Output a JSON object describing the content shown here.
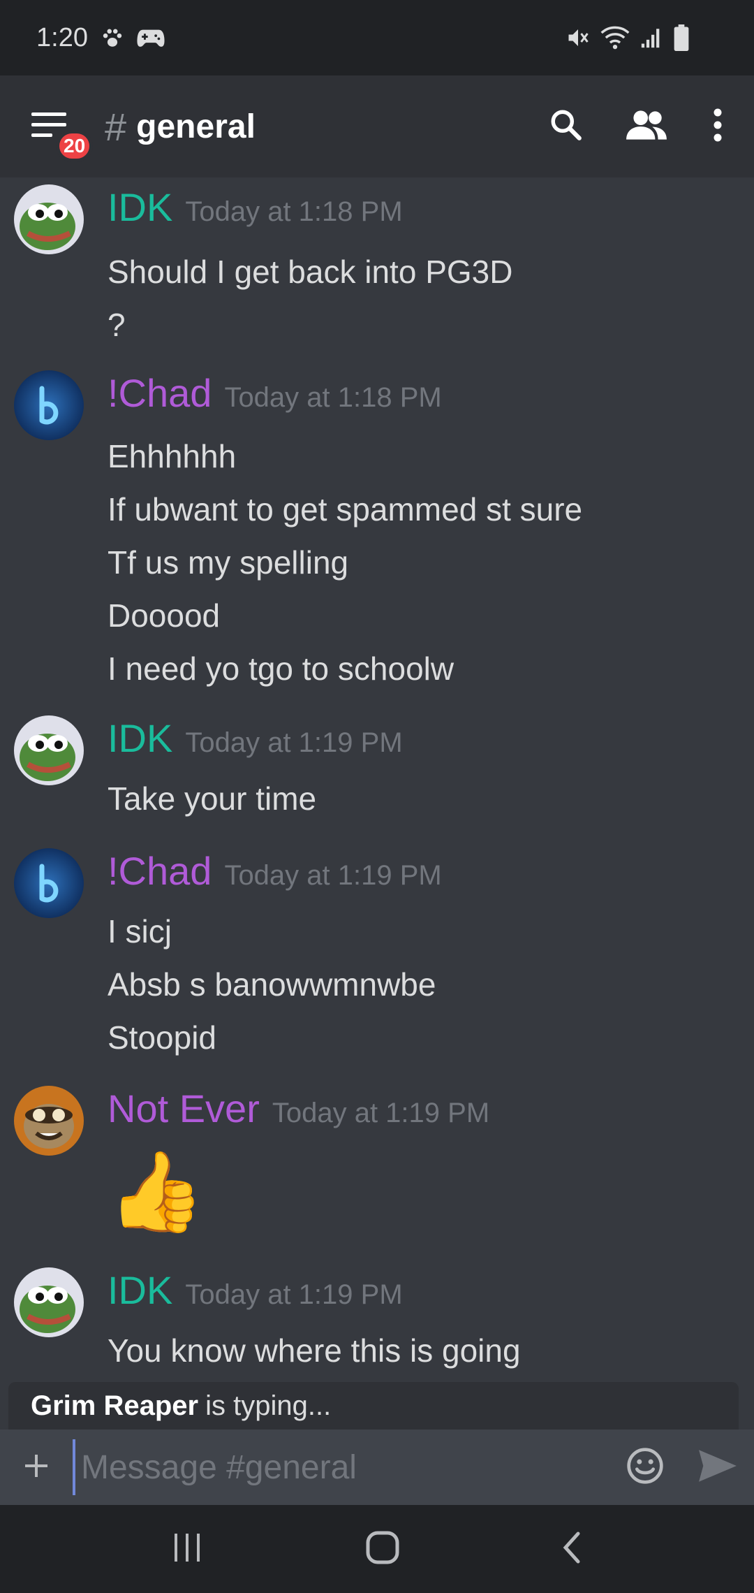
{
  "status_bar": {
    "time": "1:20",
    "left_icons": [
      "paw-icon",
      "gamepad-icon"
    ],
    "right_icons": [
      "mute-icon",
      "wifi-icon",
      "signal-icon",
      "battery-icon"
    ]
  },
  "header": {
    "menu_icon": "hamburger-menu-icon",
    "badge_count": "20",
    "channel_hash": "#",
    "channel_name": "general",
    "actions": [
      "search-icon",
      "members-icon",
      "overflow-menu-icon"
    ]
  },
  "messages": [
    {
      "author": "IDK",
      "avatar": "pepe-avatar",
      "timestamp": "Today at 1:18 PM",
      "lines": [
        "Should I get back into PG3D",
        "?"
      ]
    },
    {
      "author": "!Chad",
      "avatar": "blue-b-avatar",
      "timestamp": "Today at 1:18 PM",
      "lines": [
        "Ehhhhhh",
        "If ubwant to get spammed st sure",
        "Tf us my spelling",
        "Dooood",
        "I need yo tgo to schoolw"
      ]
    },
    {
      "author": "IDK",
      "avatar": "pepe-avatar",
      "timestamp": "Today at 1:19 PM",
      "lines": [
        "Take your time"
      ]
    },
    {
      "author": "!Chad",
      "avatar": "blue-b-avatar",
      "timestamp": "Today at 1:19 PM",
      "lines": [
        "I sicj",
        "Absb s banowwmnwbe",
        "Stoopid"
      ]
    },
    {
      "author": "Not Ever",
      "avatar": "rigby-avatar",
      "timestamp": "Today at 1:19 PM",
      "emoji": "👍"
    },
    {
      "author": "IDK",
      "avatar": "pepe-avatar",
      "timestamp": "Today at 1:19 PM",
      "lines": [
        "You know where this is going"
      ]
    }
  ],
  "typing": {
    "user": "Grim Reaper",
    "text": "is typing..."
  },
  "composer": {
    "placeholder": "Message #general",
    "value": ""
  },
  "colors": {
    "background": "#36393f",
    "header": "#2f3136",
    "idk_name": "#1abc9c",
    "chad_name": "#b05bd8",
    "badge": "#ed4245"
  }
}
